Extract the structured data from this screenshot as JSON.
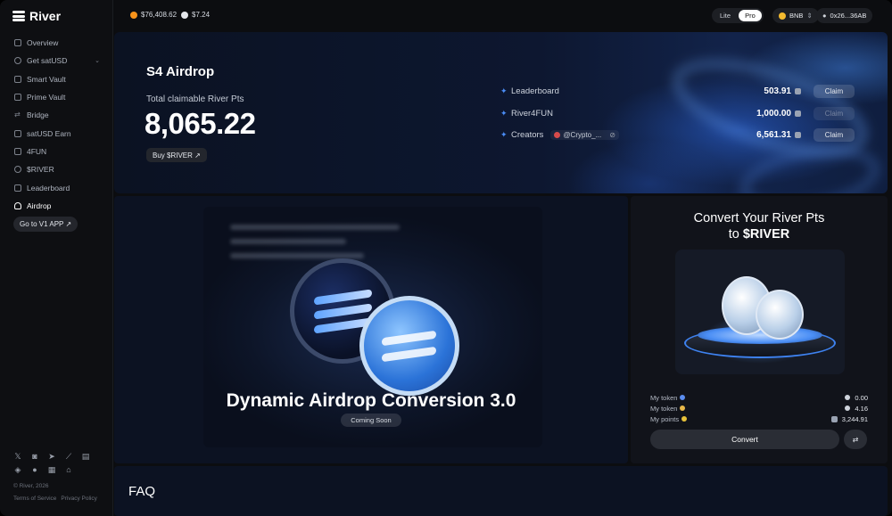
{
  "brand": {
    "name": "River"
  },
  "sidebar": {
    "items": [
      {
        "label": "Overview"
      },
      {
        "label": "Get satUSD"
      },
      {
        "label": "Smart Vault"
      },
      {
        "label": "Prime Vault"
      },
      {
        "label": "Bridge"
      },
      {
        "label": "satUSD Earn"
      },
      {
        "label": "4FUN"
      },
      {
        "label": "$RIVER"
      },
      {
        "label": "Leaderboard"
      },
      {
        "label": "Airdrop"
      }
    ],
    "v1_button": "Go to V1 APP ↗",
    "copyright": "© River, 2026",
    "terms": "Terms of Service",
    "privacy": "Privacy Policy",
    "social_icons": [
      "x-icon",
      "discord-icon",
      "telegram-icon",
      "mirror-icon",
      "docs-icon",
      "gitbook-icon",
      "github-icon",
      "defillama-icon",
      "bank-icon"
    ]
  },
  "topbar": {
    "btc_price": "$76,408.62",
    "river_price": "$7.24",
    "mode_lite": "Lite",
    "mode_pro": "Pro",
    "network": "BNB",
    "wallet": "0x26...36AB"
  },
  "hero": {
    "title": "S4 Airdrop",
    "subtitle": "Total claimable River Pts",
    "total": "8,065.22",
    "buy_label": "Buy $RIVER ↗",
    "rows": [
      {
        "label": "Leaderboard",
        "amount": "503.91",
        "claim": "Claim",
        "enabled": true
      },
      {
        "label": "River4FUN",
        "amount": "1,000.00",
        "claim": "Claim",
        "enabled": false
      },
      {
        "label": "Creators",
        "handle": "@Crypto_...",
        "amount": "6,561.31",
        "claim": "Claim",
        "enabled": true
      }
    ]
  },
  "promo": {
    "title": "Dynamic Airdrop Conversion 3.0",
    "badge": "Coming Soon"
  },
  "convert": {
    "title_line1": "Convert Your River Pts",
    "title_line2": "to",
    "title_token": "$RIVER",
    "rows": [
      {
        "label": "My token",
        "value": "0.00",
        "dot_color": "#5b8def"
      },
      {
        "label": "My token",
        "value": "4.16",
        "dot_color": "#e8b84a"
      },
      {
        "label": "My points",
        "value": "3,244.91",
        "dot_color": "#e8c23a"
      }
    ],
    "button": "Convert",
    "swap_icon": "⇄"
  },
  "faq": {
    "title": "FAQ"
  },
  "colors": {
    "accent": "#4b8df7",
    "bg": "#0c0d10"
  }
}
